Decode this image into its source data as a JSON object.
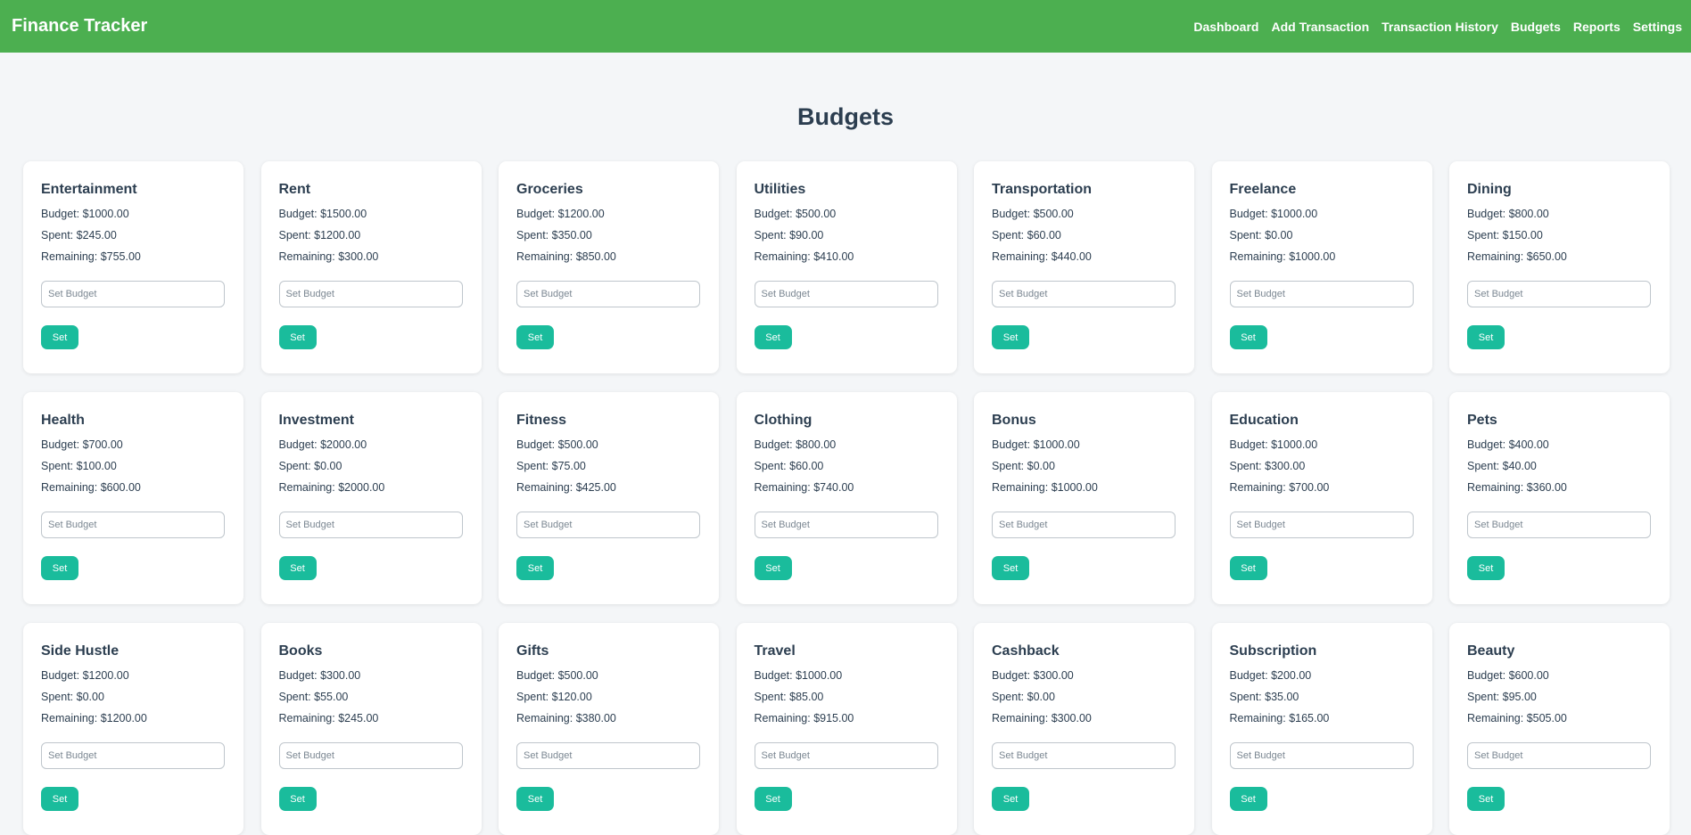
{
  "header": {
    "brand": "Finance Tracker",
    "nav": [
      "Dashboard",
      "Add Transaction",
      "Transaction History",
      "Budgets",
      "Reports",
      "Settings"
    ]
  },
  "page": {
    "title": "Budgets"
  },
  "labels": {
    "budget_prefix": "Budget: ",
    "spent_prefix": "Spent: ",
    "remaining_prefix": "Remaining: ",
    "input_placeholder": "Set Budget",
    "set_button": "Set"
  },
  "budgets": [
    {
      "name": "Entertainment",
      "budget": "$1000.00",
      "spent": "$245.00",
      "remaining": "$755.00"
    },
    {
      "name": "Rent",
      "budget": "$1500.00",
      "spent": "$1200.00",
      "remaining": "$300.00"
    },
    {
      "name": "Groceries",
      "budget": "$1200.00",
      "spent": "$350.00",
      "remaining": "$850.00"
    },
    {
      "name": "Utilities",
      "budget": "$500.00",
      "spent": "$90.00",
      "remaining": "$410.00"
    },
    {
      "name": "Transportation",
      "budget": "$500.00",
      "spent": "$60.00",
      "remaining": "$440.00"
    },
    {
      "name": "Freelance",
      "budget": "$1000.00",
      "spent": "$0.00",
      "remaining": "$1000.00"
    },
    {
      "name": "Dining",
      "budget": "$800.00",
      "spent": "$150.00",
      "remaining": "$650.00"
    },
    {
      "name": "Health",
      "budget": "$700.00",
      "spent": "$100.00",
      "remaining": "$600.00"
    },
    {
      "name": "Investment",
      "budget": "$2000.00",
      "spent": "$0.00",
      "remaining": "$2000.00"
    },
    {
      "name": "Fitness",
      "budget": "$500.00",
      "spent": "$75.00",
      "remaining": "$425.00"
    },
    {
      "name": "Clothing",
      "budget": "$800.00",
      "spent": "$60.00",
      "remaining": "$740.00"
    },
    {
      "name": "Bonus",
      "budget": "$1000.00",
      "spent": "$0.00",
      "remaining": "$1000.00"
    },
    {
      "name": "Education",
      "budget": "$1000.00",
      "spent": "$300.00",
      "remaining": "$700.00"
    },
    {
      "name": "Pets",
      "budget": "$400.00",
      "spent": "$40.00",
      "remaining": "$360.00"
    },
    {
      "name": "Side Hustle",
      "budget": "$1200.00",
      "spent": "$0.00",
      "remaining": "$1200.00"
    },
    {
      "name": "Books",
      "budget": "$300.00",
      "spent": "$55.00",
      "remaining": "$245.00"
    },
    {
      "name": "Gifts",
      "budget": "$500.00",
      "spent": "$120.00",
      "remaining": "$380.00"
    },
    {
      "name": "Travel",
      "budget": "$1000.00",
      "spent": "$85.00",
      "remaining": "$915.00"
    },
    {
      "name": "Cashback",
      "budget": "$300.00",
      "spent": "$0.00",
      "remaining": "$300.00"
    },
    {
      "name": "Subscription",
      "budget": "$200.00",
      "spent": "$35.00",
      "remaining": "$165.00"
    },
    {
      "name": "Beauty",
      "budget": "$600.00",
      "spent": "$95.00",
      "remaining": "$505.00"
    }
  ],
  "colors": {
    "header_bg": "#4caf50",
    "button_bg": "#1abc9c",
    "page_bg": "#f4f6f8",
    "text": "#2c3e50"
  }
}
